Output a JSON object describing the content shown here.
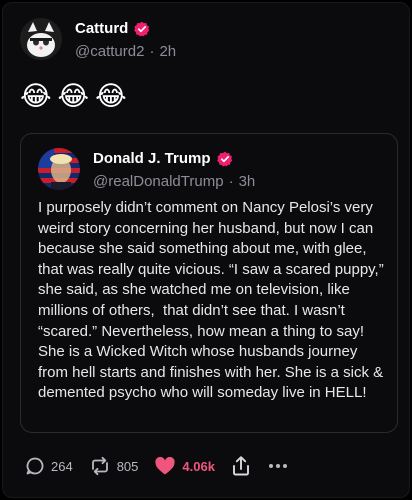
{
  "post": {
    "author_name": "Catturd",
    "author_handle": "@catturd2",
    "separator": "·",
    "timestamp": "2h",
    "emojis": "😂😂😂"
  },
  "quoted": {
    "author_name": "Donald J. Trump",
    "author_handle": "@realDonaldTrump",
    "separator": "·",
    "timestamp": "3h",
    "text": "I purposely didn’t comment on Nancy Pelosi’s very weird story concerning her husband, but now I can because she said something about me, with glee, that was really quite vicious. “I saw a scared puppy,” she said, as she watched me on television, like millions of others,  that didn’t see that. I wasn’t “scared.” Nevertheless, how mean a thing to say! She is a Wicked Witch whose husbands journey from hell starts and finishes with her. She is a sick & demented psycho who will someday live in HELL!"
  },
  "actions": {
    "replies": "264",
    "reposts": "805",
    "likes": "4.06k"
  },
  "colors": {
    "verified": "#f01f6f",
    "like": "#f0557d",
    "background": "#0b0b0e"
  },
  "icons": [
    "verified-badge-icon",
    "reply-icon",
    "repost-icon",
    "heart-icon",
    "share-icon",
    "more-icon"
  ]
}
